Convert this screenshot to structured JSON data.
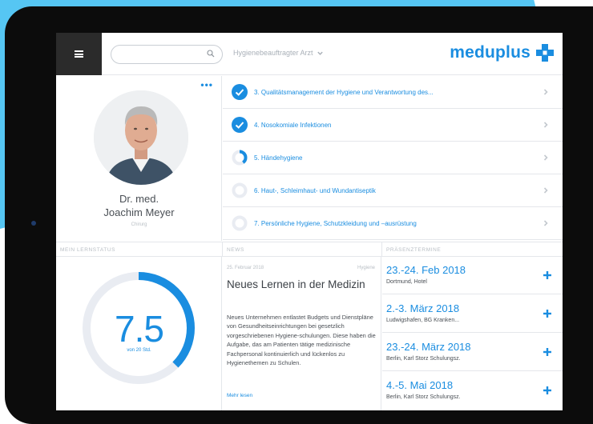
{
  "header": {
    "search_placeholder": "",
    "role_label": "Hygienebeauftragter Arzt",
    "logo": "meduplus"
  },
  "profile": {
    "title": "Dr. med.",
    "name": "Joachim Meyer",
    "department": "Chirurg"
  },
  "courses": [
    {
      "label": "3. Qualitätsmanagement der Hygiene und Verantwortung des...",
      "status": "complete",
      "progress": 1.0
    },
    {
      "label": "4. Nosokomiale Infektionen",
      "status": "complete",
      "progress": 1.0
    },
    {
      "label": "5. Händehygiene",
      "status": "in-progress",
      "progress": 0.4
    },
    {
      "label": "6. Haut-, Schleimhaut- und Wundantiseptik",
      "status": "not-started",
      "progress": 0.0
    },
    {
      "label": "7. Persönliche Hygiene, Schutzkleidung und –ausrüstung",
      "status": "not-started",
      "progress": 0.0
    }
  ],
  "sections": {
    "status": "MEIN LERNSTATUS",
    "news": "NEWS",
    "dates": "PRÄSENZTERMINE"
  },
  "learning_status": {
    "value": "7.5",
    "subtitle": "von 20 Std.",
    "progress_fraction": 0.375
  },
  "news": {
    "date": "25. Februar 2018",
    "tag": "Hygiene",
    "title": "Neues Lernen in der Medizin",
    "body": "Neues Unternehmen entlastet Budgets und Dienstpläne von Gesundheitseinrichtungen bei gesetzlich vorgeschriebenen Hygiene-schulungen. Diese haben die Aufgabe, das am Patienten tätige medizinische Fachpersonal kontinuierlich und lückenlos zu Hygienethemen zu Schulen.",
    "more_label": "Mehr lesen"
  },
  "dates": [
    {
      "date": "23.-24. Feb 2018",
      "location": "Dortmund, Hotel"
    },
    {
      "date": "2.-3. März 2018",
      "location": "Ludwigshafen, BG Kranken..."
    },
    {
      "date": "23.-24. März 2018",
      "location": "Berlin, Karl Storz Schulungsz."
    },
    {
      "date": "4.-5. Mai 2018",
      "location": "Berlin, Karl Storz Schulungsz."
    }
  ],
  "colors": {
    "accent": "#1a8de0",
    "track": "#e9ecf2",
    "background_shape": "#56c6f3",
    "device": "#0c0c0c"
  }
}
